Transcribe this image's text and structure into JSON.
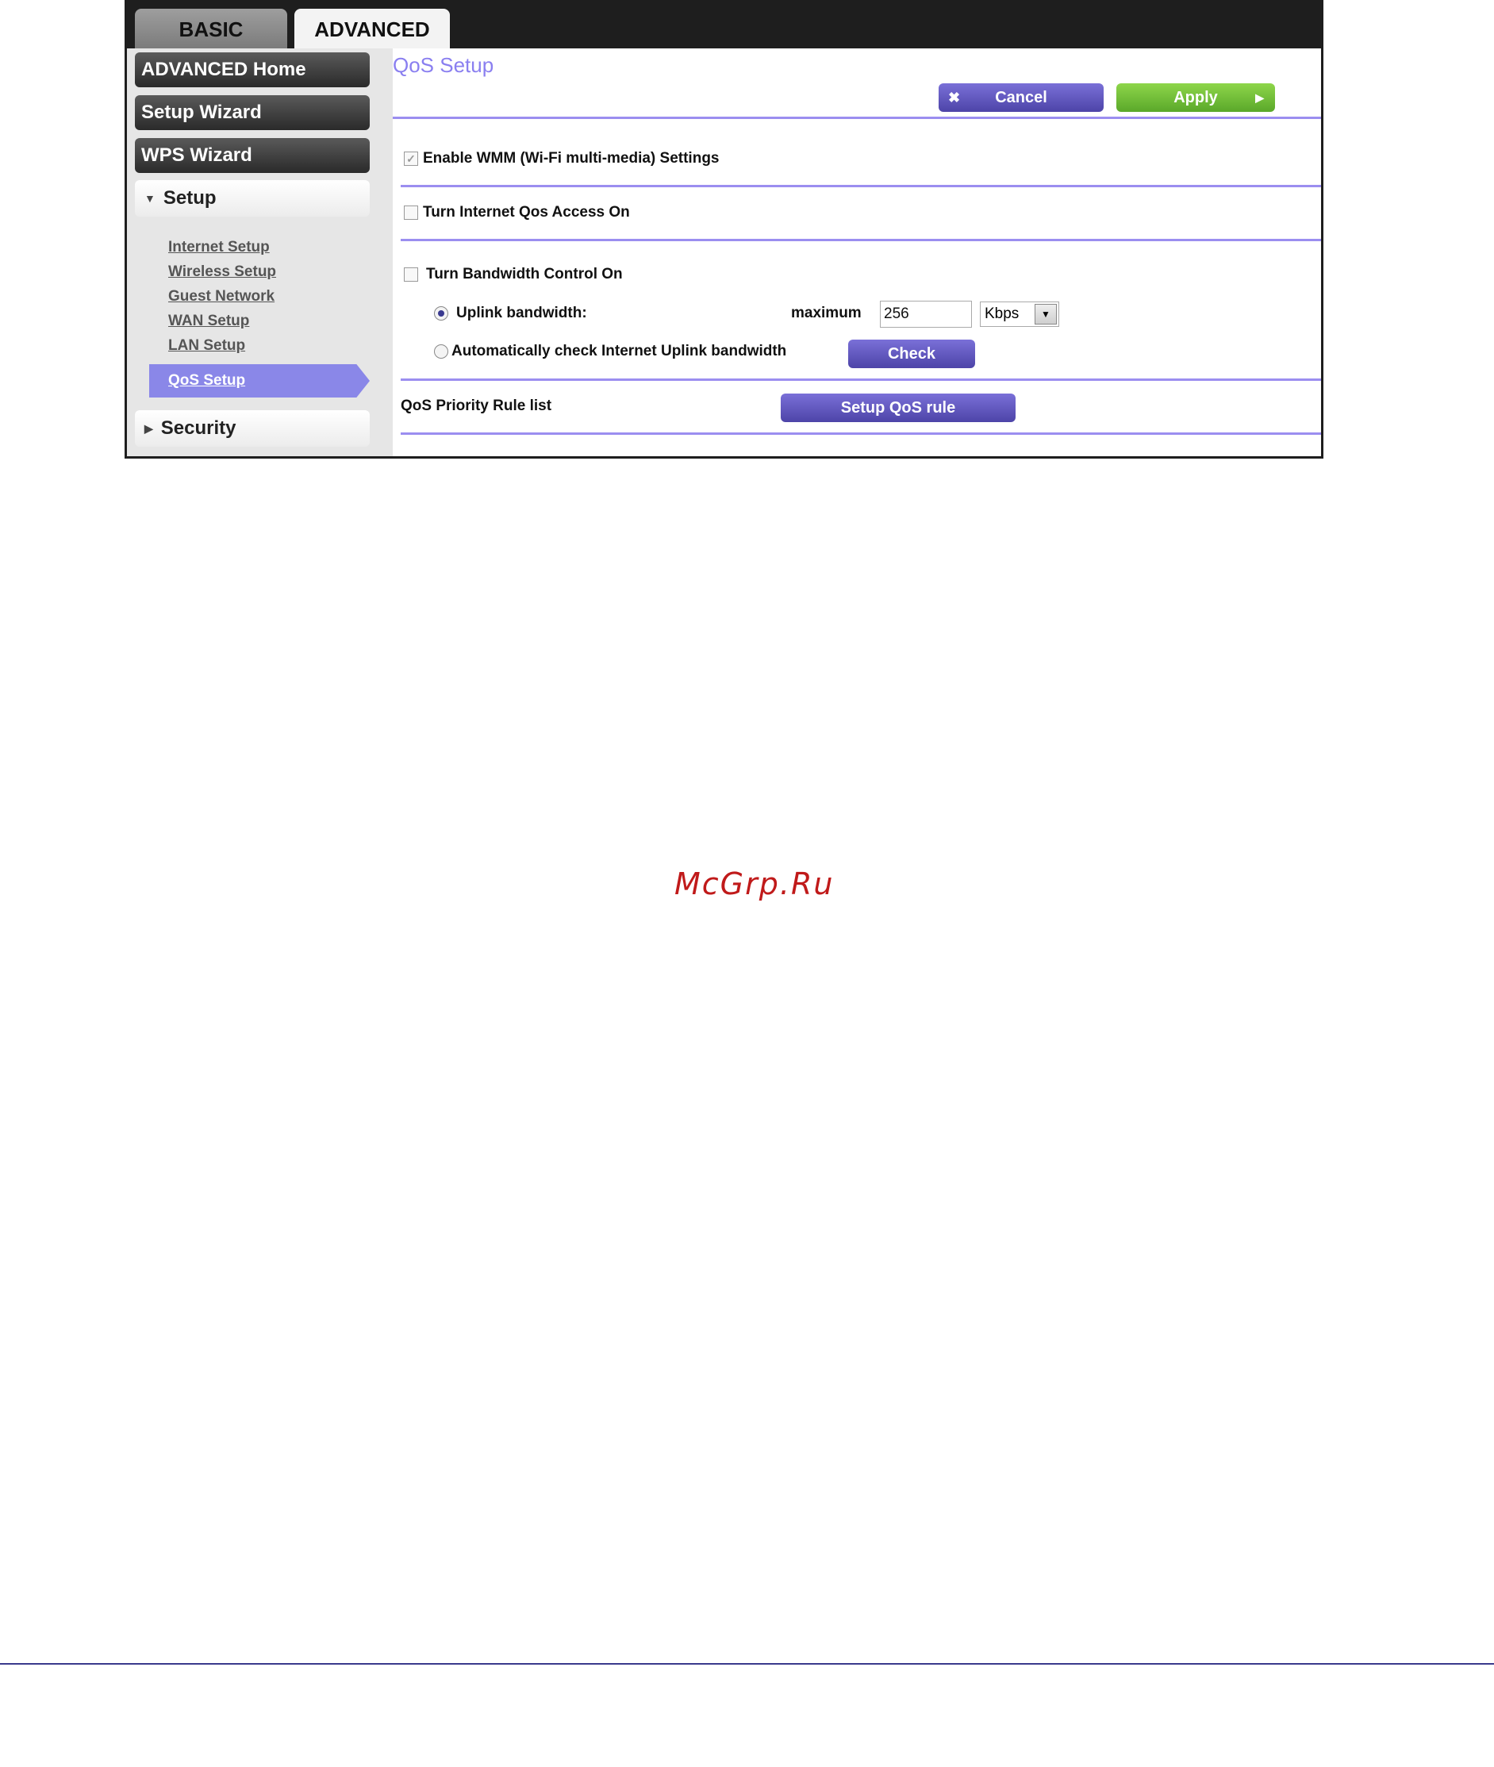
{
  "tabs": {
    "basic": "BASIC",
    "advanced": "ADVANCED"
  },
  "sidebar": {
    "advanced_home": "ADVANCED Home",
    "setup_wizard": "Setup Wizard",
    "wps_wizard": "WPS Wizard",
    "setup_section": "Setup",
    "setup_items": [
      "Internet Setup",
      "Wireless Setup",
      "Guest Network",
      "WAN Setup",
      "LAN Setup",
      "QoS Setup"
    ],
    "security_section": "Security"
  },
  "main": {
    "title": "QoS Setup",
    "cancel_label": "Cancel",
    "apply_label": "Apply",
    "enable_wmm_label": "Enable WMM (Wi-Fi multi-media) Settings",
    "enable_wmm_checked": true,
    "internet_qos_label": "Turn Internet Qos Access On",
    "internet_qos_checked": false,
    "bandwidth_control_label": "Turn Bandwidth Control On",
    "bandwidth_control_checked": false,
    "uplink_label": "Uplink bandwidth:",
    "uplink_selected": true,
    "maximum_label": "maximum",
    "maximum_value": "256",
    "unit_value": "Kbps",
    "auto_check_label": "Automatically check Internet Uplink bandwidth",
    "check_label": "Check",
    "rule_list_label": "QoS Priority Rule list",
    "setup_rule_label": "Setup QoS rule"
  },
  "watermark": "McGrp.Ru",
  "colors": {
    "accent": "#8a7ff0",
    "active_item": "#8a87e8",
    "apply": "#6ab836",
    "button": "#5a50b8"
  },
  "icons": {
    "cancel": "close-icon",
    "apply": "play-arrow-icon",
    "section_open": "triangle-down-icon",
    "section_closed": "triangle-right-icon",
    "dropdown": "chevron-down-icon"
  }
}
